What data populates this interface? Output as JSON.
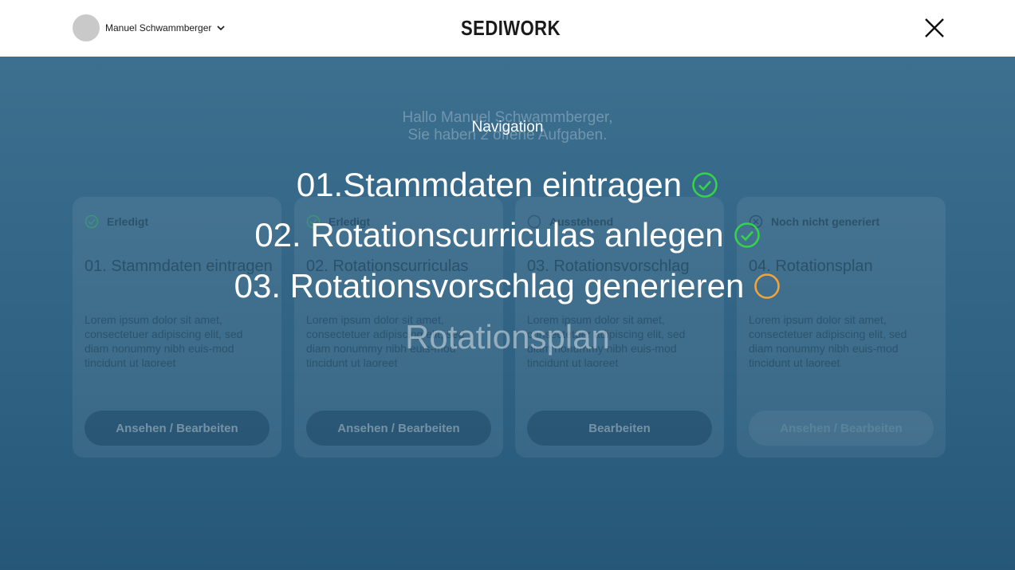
{
  "header": {
    "user_name": "Manuel Schwammberger",
    "logo": "SEDIWORK"
  },
  "dashboard": {
    "greeting_line1": "Hallo Manuel Schwammberger,",
    "greeting_line2": "Sie haben 2 offene Aufgaben.",
    "cards": [
      {
        "status": "Erledigt",
        "status_icon": "check-circle-icon",
        "title": "01. Stammdaten eintragen",
        "body": "Lorem ipsum dolor sit amet, consectetuer adipiscing elit, sed diam nonummy nibh euis-mod tincidunt ut laoreet",
        "button": "Ansehen / Bearbeiten"
      },
      {
        "status": "Erledigt",
        "status_icon": "check-circle-icon",
        "title": "02. Rotationscurriculas",
        "body": "Lorem ipsum dolor sit amet, consectetuer adipiscing elit, sed diam nonummy nibh euis-mod tincidunt ut laoreet",
        "button": "Ansehen / Bearbeiten"
      },
      {
        "status": "Ausstehend",
        "status_icon": "pending-circle-icon",
        "title": "03. Rotationsvorschlag",
        "body": "Lorem ipsum dolor sit amet, consectetuer adipiscing elit, sed diam nonummy nibh euis-mod tincidunt ut laoreet",
        "button": "Bearbeiten"
      },
      {
        "status": "Noch nicht generiert",
        "status_icon": "x-circle-icon",
        "title": "04. Rotationsplan",
        "body": "Lorem ipsum dolor sit amet, consectetuer adipiscing elit, sed diam nonummy nibh euis-mod tincidunt ut laoreet",
        "button": "Ansehen / Bearbeiten"
      }
    ]
  },
  "navigation": {
    "title": "Navigation",
    "items": [
      {
        "label": "01.Stammdaten eintragen",
        "state": "done",
        "icon": "check-circle-icon"
      },
      {
        "label": "02. Rotationscurriculas anlegen",
        "state": "done",
        "icon": "check-circle-icon"
      },
      {
        "label": "03. Rotationsvorschlag generieren",
        "state": "pending",
        "icon": "pending-circle-icon"
      },
      {
        "label": "Rotationsplan",
        "state": "disabled",
        "icon": ""
      }
    ]
  },
  "colors": {
    "done": "#35d34a",
    "pending": "#f0a43a",
    "overlay_top": "#3d6f8f",
    "overlay_bottom": "#265778"
  }
}
